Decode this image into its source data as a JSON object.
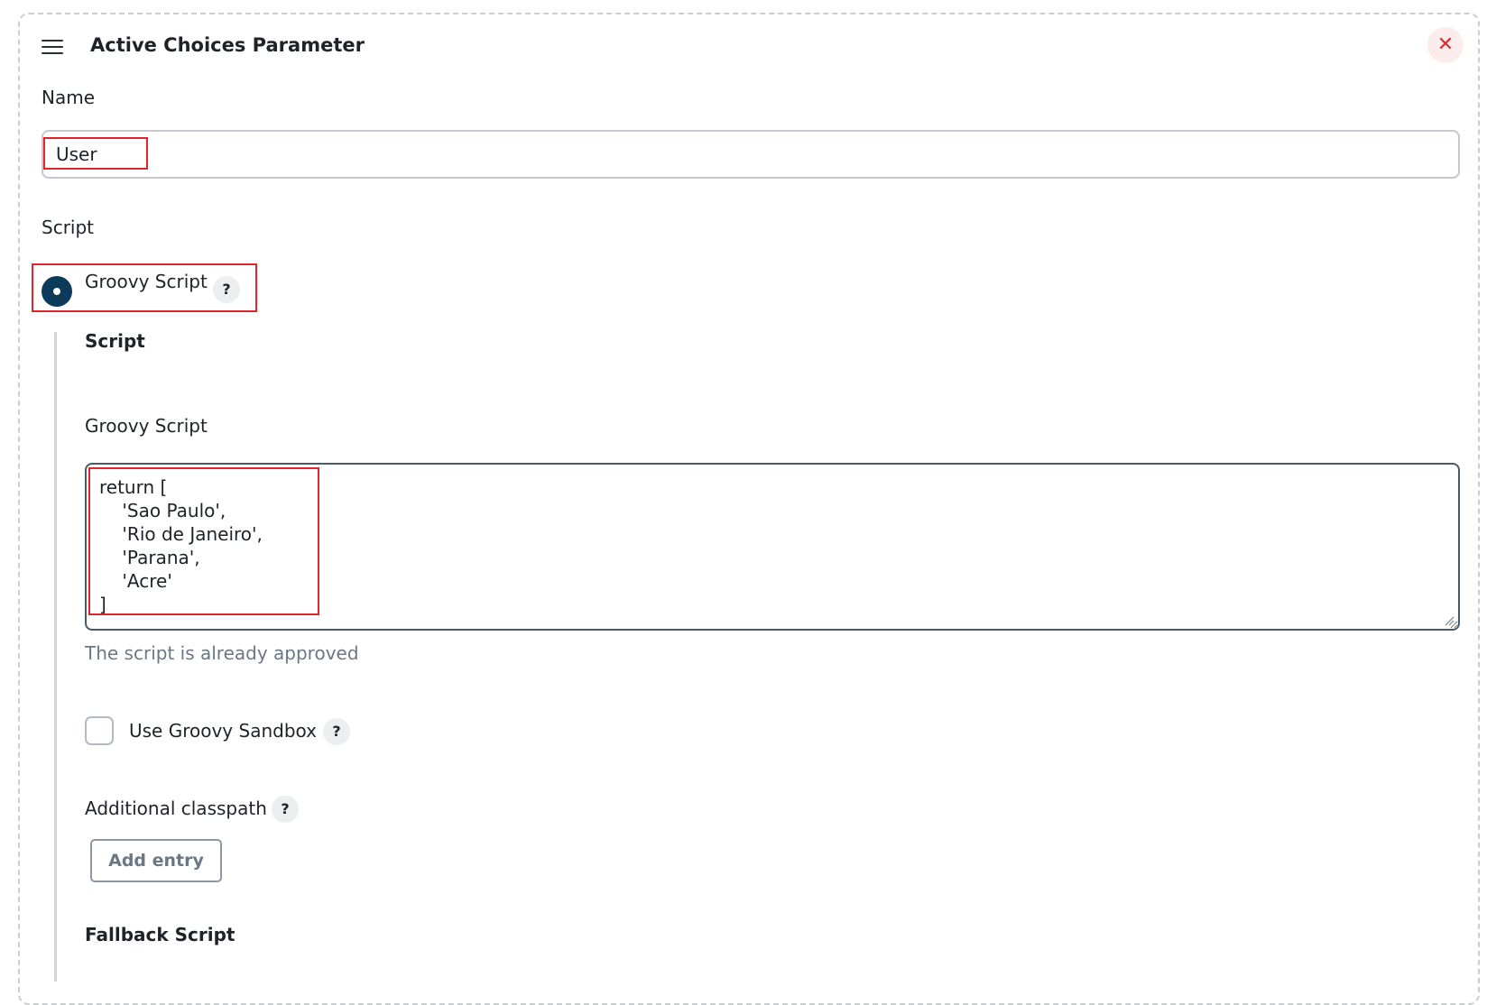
{
  "header": {
    "title": "Active Choices Parameter",
    "close_symbol": "✕"
  },
  "name_field": {
    "label": "Name",
    "value": "User"
  },
  "script_section": {
    "label": "Script",
    "radio_option": "Groovy Script",
    "help_symbol": "?",
    "subheading": "Script",
    "groovy_label": "Groovy Script",
    "groovy_code": "return [\n    'Sao Paulo',\n    'Rio de Janeiro',\n    'Parana',\n    'Acre'\n]",
    "approval_status": "The script is already approved",
    "sandbox_label": "Use Groovy Sandbox",
    "sandbox_checked": false,
    "classpath_label": "Additional classpath",
    "add_entry_label": "Add entry",
    "fallback_heading": "Fallback Script"
  },
  "colors": {
    "accent": "#0b3a5b",
    "highlight": "#e0262b",
    "close": "#d42c2c"
  },
  "icons": {
    "drag": "drag-handle-icon",
    "close": "close-icon",
    "help": "help-icon",
    "resize": "resize-grip-icon"
  }
}
